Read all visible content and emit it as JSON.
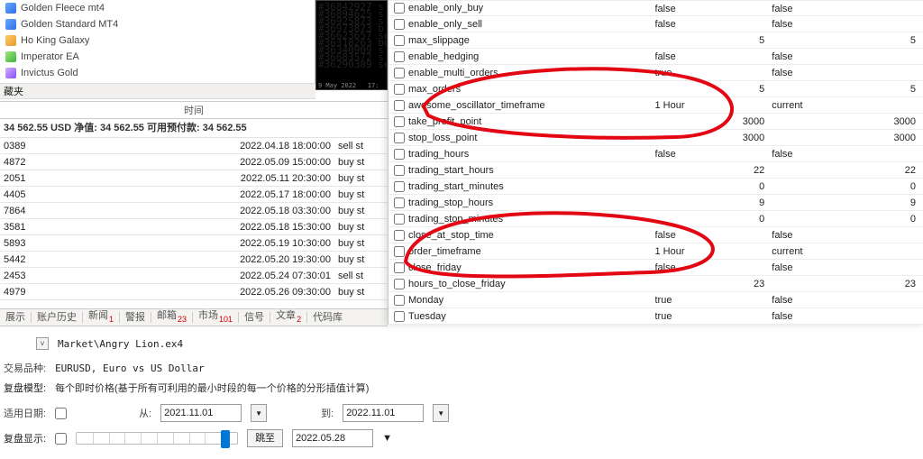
{
  "ea_tree": {
    "items": [
      "Golden Fleece mt4",
      "Golden Standard MT4",
      "Ho King Galaxy",
      "Imperator EA",
      "Invictus Gold"
    ],
    "fav_tab": "藏夹"
  },
  "mini_chart": {
    "lines": [
      "#36842927 s",
      "#36894625 s",
      "#36925873 s",
      "#36973873 b",
      "#36623657 sell",
      "#36318263 buy",
      "#36340909 s",
      "#36683572 s",
      "#36290389 se"
    ],
    "footer": "9 May 2022   17:"
  },
  "time_header": "时间",
  "balance_line": "34 562.55 USD   净值: 34 562.55   可用预付款: 34 562.55",
  "history": [
    {
      "deal": "0389",
      "time": "2022.04.18 18:00:00",
      "type": "sell st"
    },
    {
      "deal": "4872",
      "time": "2022.05.09 15:00:00",
      "type": "buy st"
    },
    {
      "deal": "2051",
      "time": "2022.05.11 20:30:00",
      "type": "buy st"
    },
    {
      "deal": "4405",
      "time": "2022.05.17 18:00:00",
      "type": "buy st"
    },
    {
      "deal": "7864",
      "time": "2022.05.18 03:30:00",
      "type": "buy st"
    },
    {
      "deal": "3581",
      "time": "2022.05.18 15:30:00",
      "type": "buy st"
    },
    {
      "deal": "5893",
      "time": "2022.05.19 10:30:00",
      "type": "buy st"
    },
    {
      "deal": "5442",
      "time": "2022.05.20 19:30:00",
      "type": "buy st"
    },
    {
      "deal": "2453",
      "time": "2022.05.24 07:30:01",
      "type": "sell st"
    },
    {
      "deal": "4979",
      "time": "2022.05.26 09:30:00",
      "type": "buy st"
    }
  ],
  "tabs": {
    "items": [
      "展示",
      "账户历史",
      "新闻",
      "警报",
      "邮箱",
      "市场",
      "信号",
      "文章",
      "代码库"
    ],
    "badges": {
      "2": "1",
      "4": "23",
      "5": "101",
      "7": "2"
    }
  },
  "file_path": "Market\\Angry Lion.ex4",
  "symbol": {
    "label": "交易品种:",
    "value": "EURUSD, Euro vs US Dollar"
  },
  "model": {
    "label": "复盘模型:",
    "value": "每个即时价格(基于所有可利用的最小时段的每一个价格的分形插值计算)"
  },
  "dates": {
    "use_label": "适用日期:",
    "from_label": "从:",
    "to_label": "到:",
    "from": "2021.11.01",
    "to": "2022.11.01"
  },
  "render": {
    "label": "复盘显示:",
    "skip_label": "跳至",
    "skip_date": "2022.05.28"
  },
  "params": [
    {
      "name": "enable_only_buy",
      "v1": "false",
      "a": "la",
      "v2": "false",
      "a2": "la"
    },
    {
      "name": "enable_only_sell",
      "v1": "false",
      "a": "la",
      "v2": "false",
      "a2": "la"
    },
    {
      "name": "max_slippage",
      "v1": "5",
      "a": "ra",
      "v2": "5",
      "a2": "ra"
    },
    {
      "name": "enable_hedging",
      "v1": "false",
      "a": "la",
      "v2": "false",
      "a2": "la"
    },
    {
      "name": "enable_multi_orders",
      "v1": "true",
      "a": "la",
      "v2": "false",
      "a2": "la"
    },
    {
      "name": "max_orders",
      "v1": "5",
      "a": "ra",
      "v2": "5",
      "a2": "ra"
    },
    {
      "name": "awesome_oscillator_timeframe",
      "v1": "1 Hour",
      "a": "la",
      "v2": "current",
      "a2": "la"
    },
    {
      "name": "take_profit_point",
      "v1": "3000",
      "a": "ra",
      "v2": "3000",
      "a2": "ra"
    },
    {
      "name": "stop_loss_point",
      "v1": "3000",
      "a": "ra",
      "v2": "3000",
      "a2": "ra"
    },
    {
      "name": "trading_hours",
      "v1": "false",
      "a": "la",
      "v2": "false",
      "a2": "la"
    },
    {
      "name": "trading_start_hours",
      "v1": "22",
      "a": "ra",
      "v2": "22",
      "a2": "ra"
    },
    {
      "name": "trading_start_minutes",
      "v1": "0",
      "a": "ra",
      "v2": "0",
      "a2": "ra"
    },
    {
      "name": "trading_stop_hours",
      "v1": "9",
      "a": "ra",
      "v2": "9",
      "a2": "ra"
    },
    {
      "name": "trading_stop_minutes",
      "v1": "0",
      "a": "ra",
      "v2": "0",
      "a2": "ra"
    },
    {
      "name": "close_at_stop_time",
      "v1": "false",
      "a": "la",
      "v2": "false",
      "a2": "la"
    },
    {
      "name": "order_timeframe",
      "v1": "1 Hour",
      "a": "la",
      "v2": "current",
      "a2": "la"
    },
    {
      "name": "close_friday",
      "v1": "false",
      "a": "la",
      "v2": "false",
      "a2": "la"
    },
    {
      "name": "hours_to_close_friday",
      "v1": "23",
      "a": "ra",
      "v2": "23",
      "a2": "ra"
    },
    {
      "name": "Monday",
      "v1": "true",
      "a": "la",
      "v2": "false",
      "a2": "la"
    },
    {
      "name": "Tuesday",
      "v1": "true",
      "a": "la",
      "v2": "false",
      "a2": "la"
    }
  ]
}
